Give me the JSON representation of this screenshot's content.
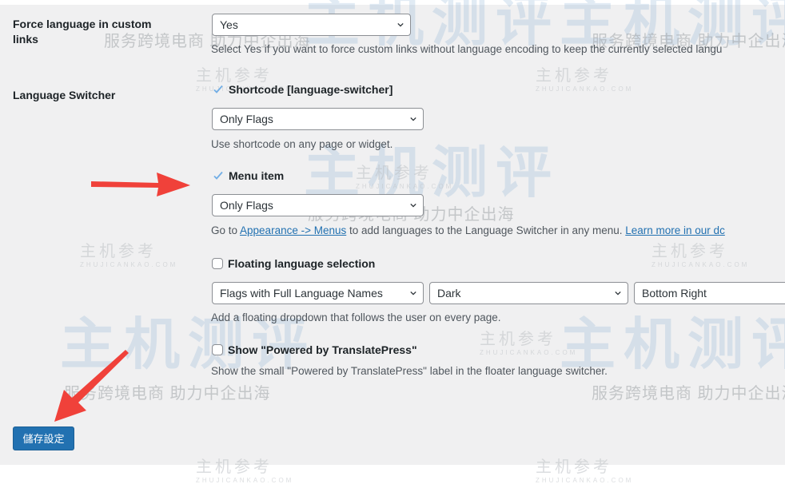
{
  "settings": {
    "force_language": {
      "label": "Force language in custom links",
      "value": "Yes",
      "description": "Select Yes if you want to force custom links without language encoding to keep the currently selected langu"
    },
    "language_switcher": {
      "label": "Language Switcher",
      "shortcode": {
        "checked": true,
        "label": "Shortcode [language-switcher]",
        "value": "Only Flags",
        "description": "Use shortcode on any page or widget."
      },
      "menu_item": {
        "checked": true,
        "label": "Menu item",
        "value": "Only Flags",
        "description_prefix": "Go to ",
        "link_appearance": "Appearance -> Menus",
        "description_middle": " to add languages to the Language Switcher in any menu. ",
        "link_learn_more": "Learn more in our dc"
      },
      "floating": {
        "checked": false,
        "label": "Floating language selection",
        "style_value": "Flags with Full Language Names",
        "theme_value": "Dark",
        "position_value": "Bottom Right",
        "description": "Add a floating dropdown that follows the user on every page."
      },
      "powered_by": {
        "checked": false,
        "label": "Show \"Powered by TranslatePress\"",
        "description": "Show the small \"Powered by TranslatePress\" label in the floater language switcher."
      }
    }
  },
  "save_button": {
    "label": "儲存設定"
  },
  "annotations": {
    "arrow_color": "#f0413a"
  },
  "watermark": {
    "brand": "主机参考",
    "domain": "ZHUJICANKAO.COM",
    "slogan": "服务跨境电商 助力中企出海",
    "big": "主机测评"
  },
  "colors": {
    "accent": "#2271b1",
    "panel_bg": "#f0f0f1"
  }
}
